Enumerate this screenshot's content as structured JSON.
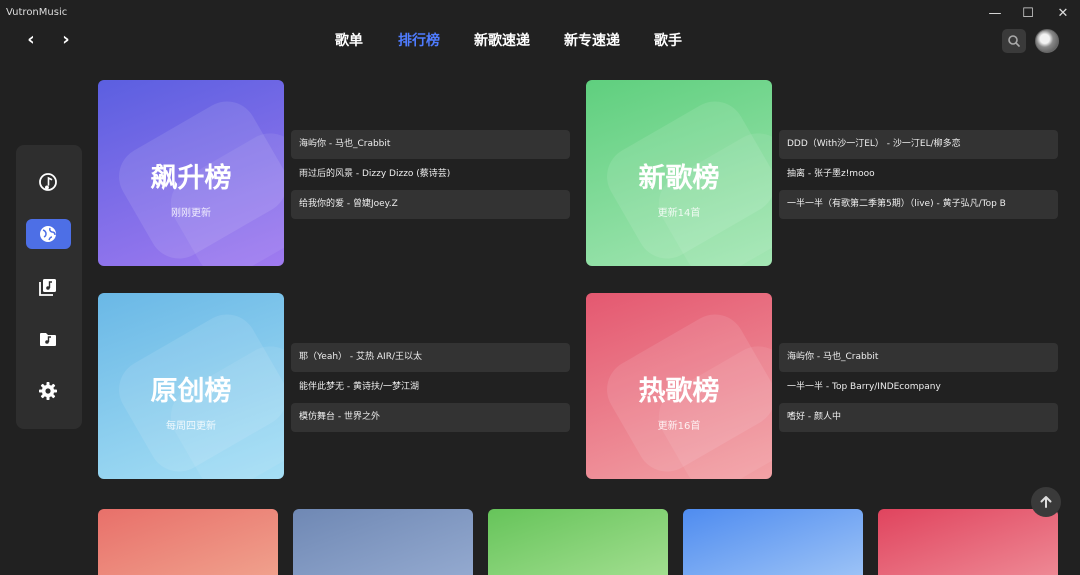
{
  "window": {
    "title": "VutronMusic",
    "minimize": "—",
    "maximize": "☐",
    "close": "✕"
  },
  "nav": {
    "back": "‹",
    "forward": "›"
  },
  "tabs": [
    {
      "label": "歌单",
      "active": false
    },
    {
      "label": "排行榜",
      "active": true
    },
    {
      "label": "新歌速递",
      "active": false
    },
    {
      "label": "新专速递",
      "active": false
    },
    {
      "label": "歌手",
      "active": false
    }
  ],
  "sidebar": {
    "items": [
      {
        "icon": "music-note-icon",
        "active": false
      },
      {
        "icon": "globe-icon",
        "active": true
      },
      {
        "icon": "music-library-icon",
        "active": false
      },
      {
        "icon": "music-folder-icon",
        "active": false
      },
      {
        "icon": "gear-icon",
        "active": false
      }
    ]
  },
  "charts": [
    {
      "name": "飙升榜",
      "sub": "刚刚更新",
      "gradient": [
        "#5b5fe0",
        "#a07bf0"
      ],
      "songs": [
        "海屿你 - 马也_Crabbit",
        "雨过后的风景 - Dizzy Dizzo (蔡诗芸)",
        "给我你的爱 - 曾婕Joey.Z"
      ]
    },
    {
      "name": "新歌榜",
      "sub": "更新14首",
      "gradient": [
        "#5fcf7e",
        "#a4e6b4"
      ],
      "songs": [
        "DDD（With沙一汀EL） - 沙一汀EL/柳多恋",
        "抽离 - 张子墨z!mooo",
        "一半一半（有歌第二季第5期）（live) - 黄子弘凡/Top B"
      ]
    },
    {
      "name": "原创榜",
      "sub": "每周四更新",
      "gradient": [
        "#6ab8e6",
        "#a6dff5"
      ],
      "songs": [
        "耶（Yeah） - 艾热 AIR/王以太",
        "能伴此梦无 - 黄诗扶/一梦江湖",
        "模仿舞台 - 世界之外"
      ]
    },
    {
      "name": "热歌榜",
      "sub": "更新16首",
      "gradient": [
        "#e45870",
        "#f2a2a6"
      ],
      "songs": [
        "海屿你 - 马也_Crabbit",
        "一半一半 - Top Barry/INDEcompany",
        "嗜好 - 颜人中"
      ]
    }
  ],
  "bottom_cards": [
    {
      "gradient": [
        "#e8706a",
        "#f0a08c"
      ]
    },
    {
      "gradient": [
        "#6f88b4",
        "#93a9cf"
      ]
    },
    {
      "gradient": [
        "#66c45a",
        "#a1de8f"
      ]
    },
    {
      "gradient": [
        "#4f8cf0",
        "#9bc2f6"
      ]
    },
    {
      "gradient": [
        "#e0445e",
        "#ee8894"
      ]
    }
  ],
  "scroll_top_icon": "arrow-up-icon"
}
